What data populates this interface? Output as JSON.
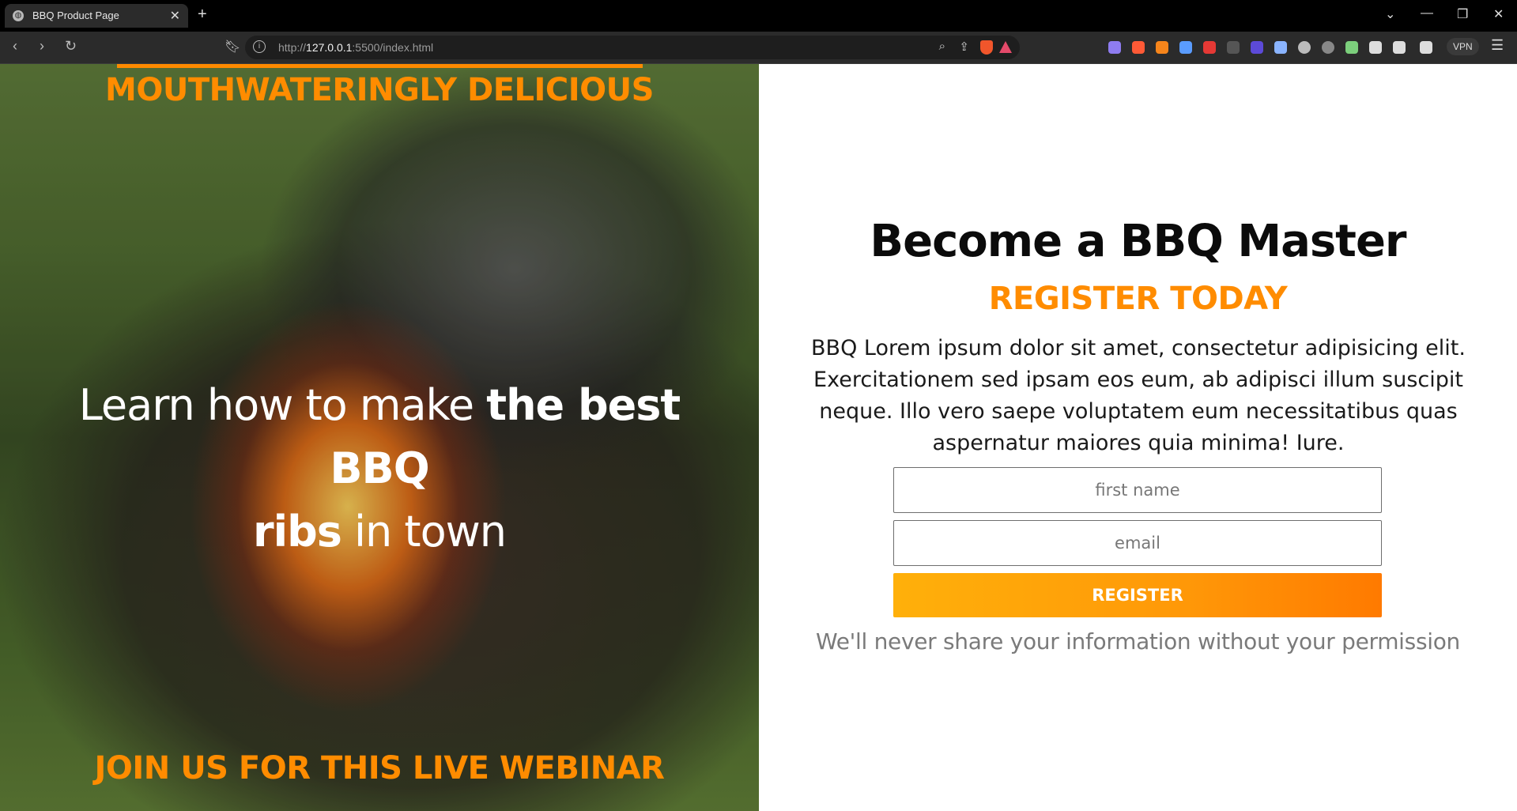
{
  "browser": {
    "tab_title": "BBQ Product Page",
    "tab_close": "✕",
    "new_tab": "+",
    "url_prefix": "http://",
    "url_host": "127.0.0.1",
    "url_rest": ":5500/index.html",
    "vpn_label": "VPN",
    "window_controls": {
      "dropdown": "⌄",
      "minimize": "—",
      "restore": "❐",
      "close": "✕"
    },
    "nav": {
      "back": "‹",
      "forward": "›",
      "reload": "↻"
    }
  },
  "hero": {
    "top_tagline": "MOUTHWATERINGLY DELICIOUS",
    "headline_part1": "Learn how to make ",
    "headline_bold1": "the best BBQ",
    "headline_bold2": "ribs",
    "headline_part2": " in town",
    "bottom_tagline": "JOIN US FOR THIS LIVE WEBINAR",
    "accent_color": "#ff8c00"
  },
  "register": {
    "title": "Become a BBQ Master",
    "subtitle": "REGISTER TODAY",
    "description": "BBQ Lorem ipsum dolor sit amet, consectetur adipisicing elit. Exercitationem sed ipsam eos eum, ab adipisci illum suscipit neque. Illo vero saepe voluptatem eum necessitatibus quas aspernatur maiores quia minima! Iure.",
    "first_name_placeholder": "first name",
    "email_placeholder": "email",
    "button_label": "REGISTER",
    "privacy_note": "We'll never share your information without your permission"
  }
}
